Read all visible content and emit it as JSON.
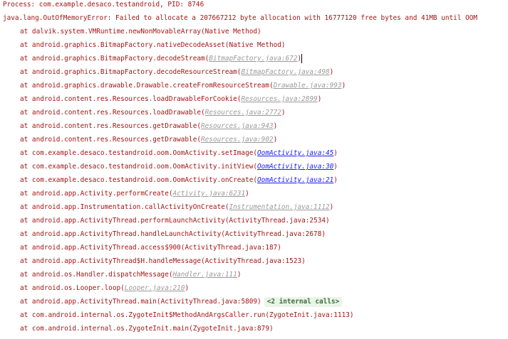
{
  "header": {
    "process_line": "Process: com.example.desaco.testandroid, PID: 8746",
    "exception_line": "java.lang.OutOfMemoryError: Failed to allocate a 207667212 byte allocation with 16777120 free bytes and 41MB until OOM"
  },
  "frames": [
    {
      "method": "at dalvik.system.VMRuntime.newNonMovableArray",
      "src": "Native Method",
      "kind": "plain"
    },
    {
      "method": "at android.graphics.BitmapFactory.nativeDecodeAsset",
      "src": "Native Method",
      "kind": "plain"
    },
    {
      "method": "at android.graphics.BitmapFactory.decodeStream",
      "src": "BitmapFactory.java:672",
      "kind": "gray"
    },
    {
      "method": "at android.graphics.BitmapFactory.decodeResourceStream",
      "src": "BitmapFactory.java:498",
      "kind": "gray"
    },
    {
      "method": "at android.graphics.drawable.Drawable.createFromResourceStream",
      "src": "Drawable.java:993",
      "kind": "gray"
    },
    {
      "method": "at android.content.res.Resources.loadDrawableForCookie",
      "src": "Resources.java:2899",
      "kind": "gray"
    },
    {
      "method": "at android.content.res.Resources.loadDrawable",
      "src": "Resources.java:2772",
      "kind": "gray"
    },
    {
      "method": "at android.content.res.Resources.getDrawable",
      "src": "Resources.java:943",
      "kind": "gray"
    },
    {
      "method": "at android.content.res.Resources.getDrawable",
      "src": "Resources.java:902",
      "kind": "gray"
    },
    {
      "method": "at com.example.desaco.testandroid.oom.OomActivity.setImage",
      "src": "OomActivity.java:45",
      "kind": "blue"
    },
    {
      "method": "at com.example.desaco.testandroid.oom.OomActivity.initView",
      "src": "OomActivity.java:30",
      "kind": "blue"
    },
    {
      "method": "at com.example.desaco.testandroid.oom.OomActivity.onCreate",
      "src": "OomActivity.java:21",
      "kind": "blue"
    },
    {
      "method": "at android.app.Activity.performCreate",
      "src": "Activity.java:6231",
      "kind": "gray"
    },
    {
      "method": "at android.app.Instrumentation.callActivityOnCreate",
      "src": "Instrumentation.java:1112",
      "kind": "gray"
    },
    {
      "method": "at android.app.ActivityThread.performLaunchActivity",
      "src": "ActivityThread.java:2534",
      "kind": "plain"
    },
    {
      "method": "at android.app.ActivityThread.handleLaunchActivity",
      "src": "ActivityThread.java:2678",
      "kind": "plain"
    },
    {
      "method": "at android.app.ActivityThread.access$900",
      "src": "ActivityThread.java:187",
      "kind": "plain"
    },
    {
      "method": "at android.app.ActivityThread$H.handleMessage",
      "src": "ActivityThread.java:1523",
      "kind": "plain"
    },
    {
      "method": "at android.os.Handler.dispatchMessage",
      "src": "Handler.java:111",
      "kind": "gray"
    },
    {
      "method": "at android.os.Looper.loop",
      "src": "Looper.java:210",
      "kind": "gray"
    },
    {
      "method": "at android.app.ActivityThread.main",
      "src": "ActivityThread.java:5809",
      "kind": "plain",
      "fold": "<2 internal calls>"
    },
    {
      "method": "at com.android.internal.os.ZygoteInit$MethodAndArgsCaller.run",
      "src": "ZygoteInit.java:1113",
      "kind": "plain"
    },
    {
      "method": "at com.android.internal.os.ZygoteInit.main",
      "src": "ZygoteInit.java:879",
      "kind": "plain"
    }
  ],
  "colors": {
    "error_text": "#a31515",
    "link_gray": "#9a9a9a",
    "link_blue": "#1a1aff",
    "fold_bg": "#eaf5e8"
  }
}
